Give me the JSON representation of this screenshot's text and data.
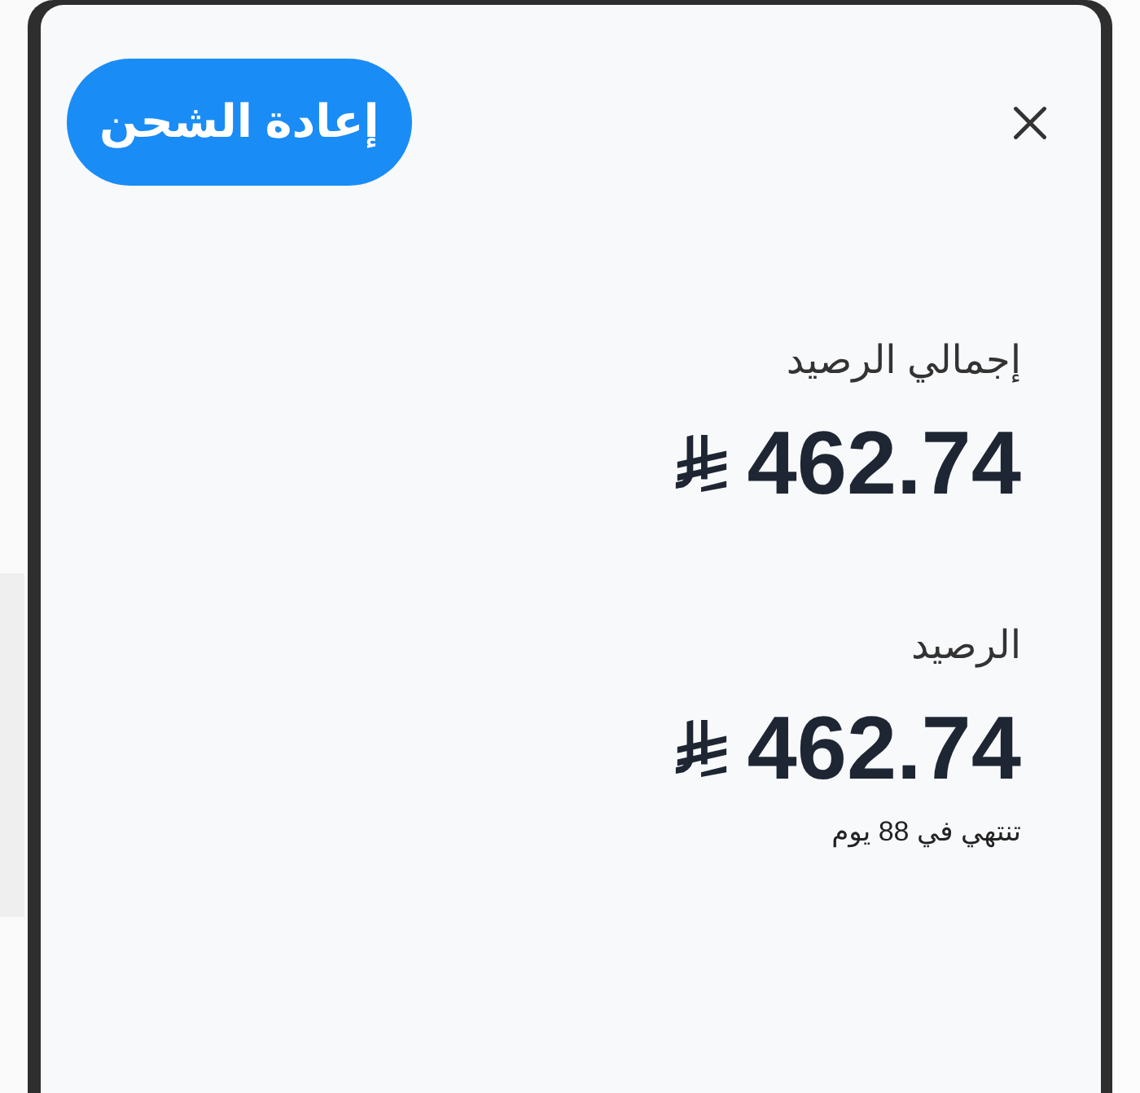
{
  "sheet": {
    "recharge_button": "إعادة الشحن"
  },
  "balances": [
    {
      "label": "إجمالي الرصيد",
      "amount": "462.74"
    },
    {
      "label": "الرصيد",
      "amount": "462.74",
      "note": "تنتهي في 88 يوم"
    }
  ]
}
